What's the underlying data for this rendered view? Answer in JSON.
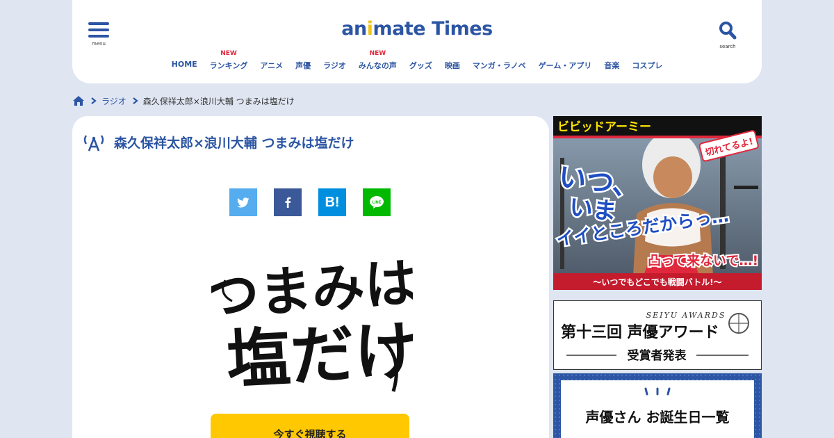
{
  "header": {
    "logo_main": "an",
    "logo_i": "i",
    "logo_rest": "mate Times",
    "menu_label": "menu",
    "search_label": "search"
  },
  "nav": {
    "items": [
      {
        "label": "HOME",
        "badge": ""
      },
      {
        "label": "ランキング",
        "badge": "NEW"
      },
      {
        "label": "アニメ",
        "badge": ""
      },
      {
        "label": "声優",
        "badge": ""
      },
      {
        "label": "ラジオ",
        "badge": ""
      },
      {
        "label": "みんなの声",
        "badge": "NEW"
      },
      {
        "label": "グッズ",
        "badge": ""
      },
      {
        "label": "映画",
        "badge": ""
      },
      {
        "label": "マンガ・ラノベ",
        "badge": ""
      },
      {
        "label": "ゲーム・アプリ",
        "badge": ""
      },
      {
        "label": "音楽",
        "badge": ""
      },
      {
        "label": "コスプレ",
        "badge": ""
      }
    ]
  },
  "breadcrumb": {
    "category": "ラジオ",
    "current": "森久保祥太郎×浪川大輔 つまみは塩だけ"
  },
  "article": {
    "title": "森久保祥太郎×浪川大輔 つまみは塩だけ",
    "hero_line1": "つまみは",
    "hero_line2": "塩だけ",
    "cta_label": "今すぐ視聴する"
  },
  "share": {
    "twitter_color": "#55acee",
    "facebook_color": "#3b5998",
    "hatena_color": "#008fde",
    "line_color": "#00b900",
    "hatena_label": "B!",
    "line_label": "LINE"
  },
  "sidebar": {
    "ad1_brand": "ビビッドアーミー",
    "ad1_tag": "切れてるよ!",
    "ad1_line1": "いつ、",
    "ad1_line2": "いま",
    "ad1_line3": "イイところだからっ…",
    "ad1_line4": "凸って来ないで…!",
    "ad1_footer": "〜いつでもどこでも戦闘バトル!〜",
    "ad2_sub": "SEIYU AWARDS",
    "ad2_title": "第十三回 声優アワード",
    "ad2_caption": "受賞者発表",
    "ad3_title": "声優さん お誕生日一覧"
  },
  "colors": {
    "brand_blue": "#2c55a3",
    "accent_yellow": "#ffc800",
    "badge_red": "#e0283c",
    "page_bg": "#dfe5f1"
  }
}
